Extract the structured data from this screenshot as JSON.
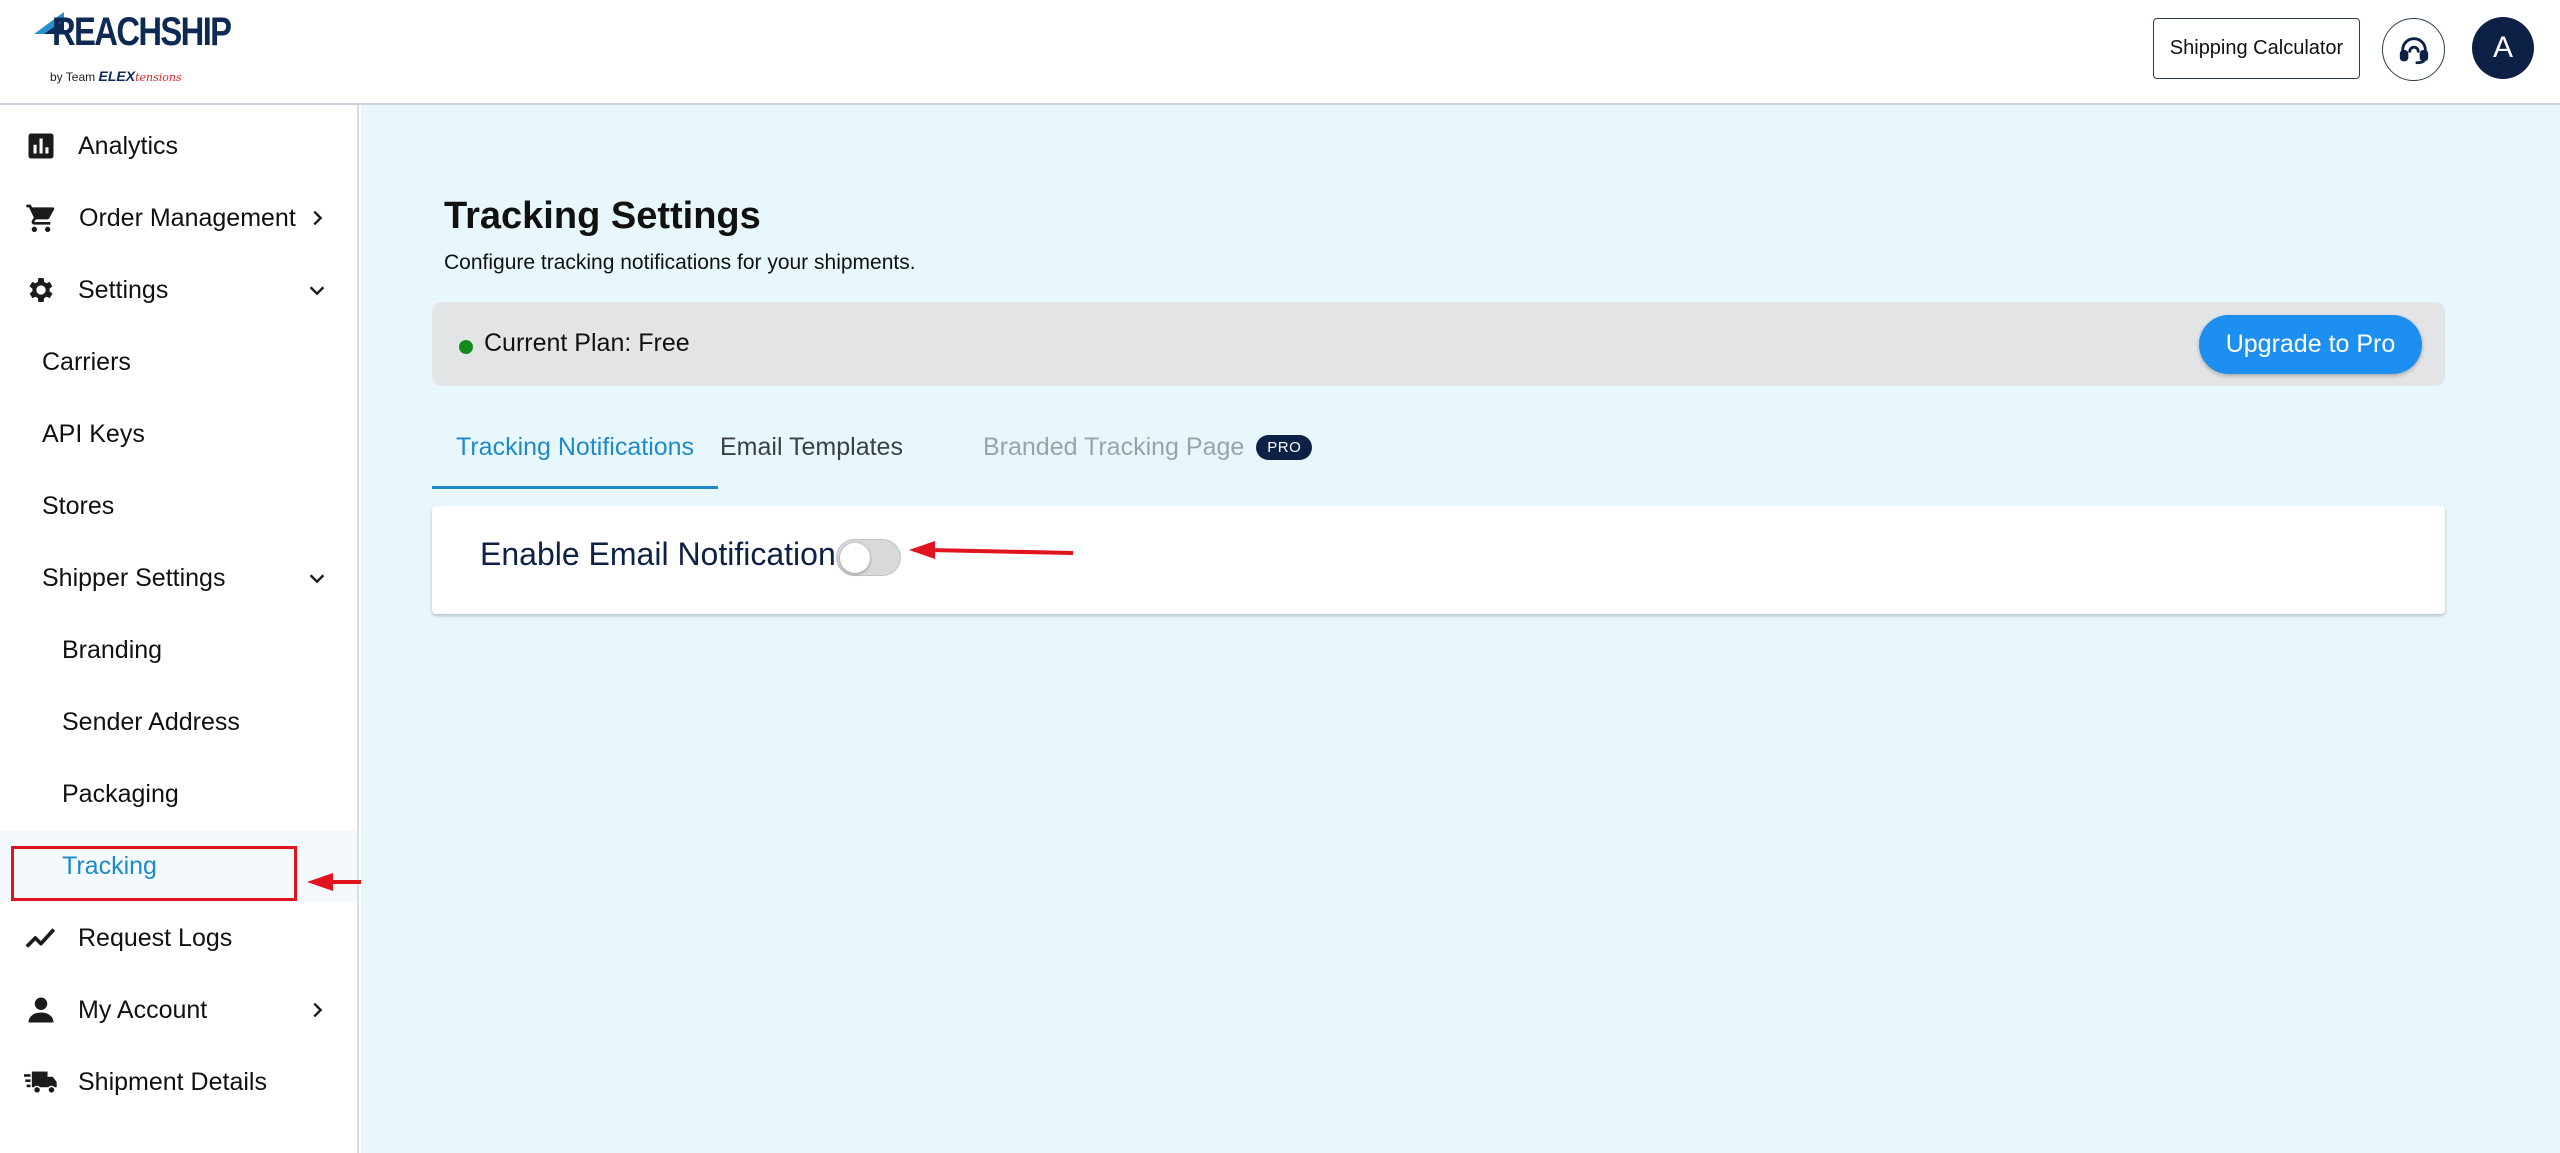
{
  "header": {
    "logo_text": "REACHSHIP",
    "logo_byline_prefix": "by Team",
    "logo_byline_brand": "ELEX",
    "logo_byline_script": "tensions",
    "shipping_calculator_label": "Shipping Calculator",
    "avatar_initial": "A"
  },
  "sidebar": {
    "items": [
      {
        "label": "Analytics",
        "icon": "bar-chart-icon"
      },
      {
        "label": "Order Management",
        "icon": "cart-icon"
      },
      {
        "label": "Settings",
        "icon": "gear-icon"
      },
      {
        "label": "Carriers"
      },
      {
        "label": "API Keys"
      },
      {
        "label": "Stores"
      },
      {
        "label": "Shipper Settings"
      },
      {
        "label": "Branding"
      },
      {
        "label": "Sender Address"
      },
      {
        "label": "Packaging"
      },
      {
        "label": "Tracking",
        "active": true
      },
      {
        "label": "Request Logs",
        "icon": "trending-line-icon"
      },
      {
        "label": "My Account",
        "icon": "person-icon"
      },
      {
        "label": "Shipment Details",
        "icon": "truck-icon"
      }
    ]
  },
  "main": {
    "title": "Tracking Settings",
    "subtitle": "Configure tracking notifications for your shipments.",
    "plan": {
      "text": "Current Plan: Free",
      "status_color": "#138a1e",
      "upgrade_label": "Upgrade to Pro"
    },
    "tabs": [
      {
        "label": "Tracking Notifications",
        "state": "active"
      },
      {
        "label": "Email Templates",
        "state": "normal"
      },
      {
        "label": "Branded Tracking Page",
        "state": "disabled",
        "badge": "PRO"
      }
    ],
    "email_notification": {
      "label": "Enable Email Notification",
      "enabled": false
    }
  },
  "colors": {
    "accent": "#1e8ac9",
    "primary_button": "#1d8ff0",
    "navy": "#0d2147",
    "main_background": "#e8f7fc",
    "annotation_red": "#e0141e"
  }
}
